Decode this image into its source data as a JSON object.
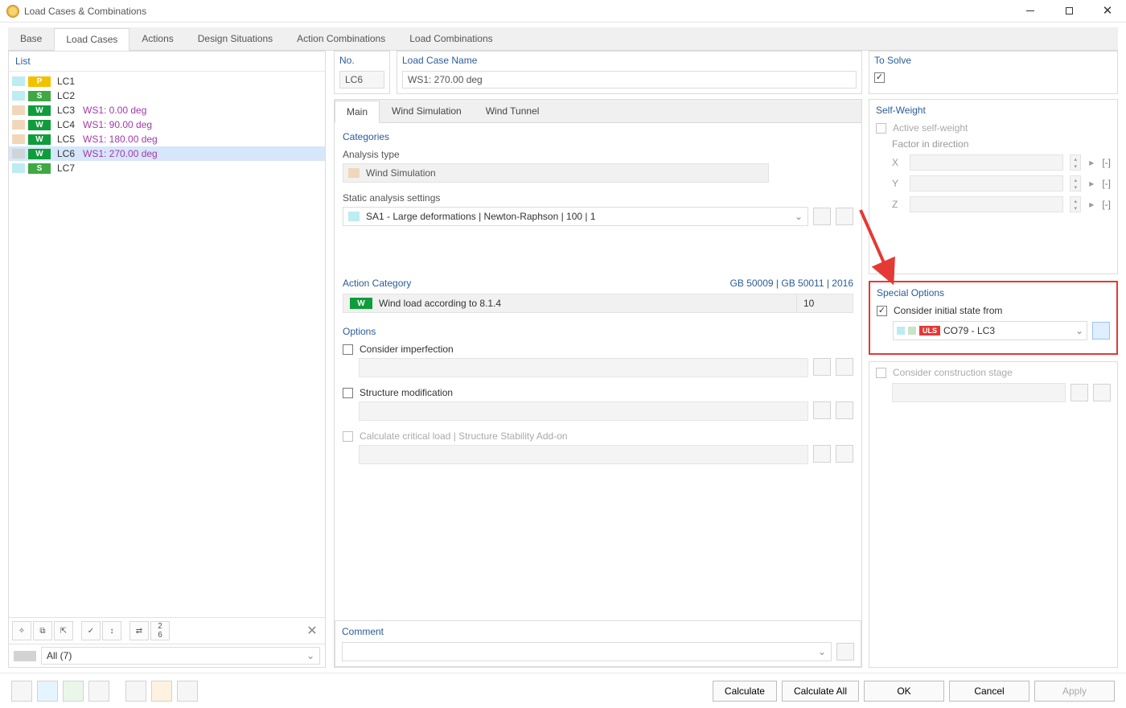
{
  "window": {
    "title": "Load Cases & Combinations"
  },
  "mainTabs": [
    "Base",
    "Load Cases",
    "Actions",
    "Design Situations",
    "Action Combinations",
    "Load Combinations"
  ],
  "mainTabActive": 1,
  "list": {
    "header": "List",
    "items": [
      {
        "sw": "cyan",
        "badge": "P",
        "badgeCls": "P",
        "id": "LC1",
        "name": ""
      },
      {
        "sw": "cyan",
        "badge": "S",
        "badgeCls": "S",
        "id": "LC2",
        "name": ""
      },
      {
        "sw": "tan",
        "badge": "W",
        "badgeCls": "W",
        "id": "LC3",
        "name": "WS1: 0.00 deg"
      },
      {
        "sw": "tan",
        "badge": "W",
        "badgeCls": "W",
        "id": "LC4",
        "name": "WS1: 90.00 deg"
      },
      {
        "sw": "tan",
        "badge": "W",
        "badgeCls": "W",
        "id": "LC5",
        "name": "WS1: 180.00 deg"
      },
      {
        "sw": "grey",
        "badge": "W",
        "badgeCls": "W",
        "id": "LC6",
        "name": "WS1: 270.00 deg",
        "sel": true
      },
      {
        "sw": "cyan",
        "badge": "S",
        "badgeCls": "S",
        "id": "LC7",
        "name": ""
      }
    ],
    "filter": "All (7)"
  },
  "no": {
    "label": "No.",
    "value": "LC6"
  },
  "name": {
    "label": "Load Case Name",
    "value": "WS1: 270.00 deg"
  },
  "solve": {
    "label": "To Solve"
  },
  "subTabs": [
    "Main",
    "Wind Simulation",
    "Wind Tunnel"
  ],
  "subTabActive": 0,
  "categories": {
    "header": "Categories",
    "analysisTypeLabel": "Analysis type",
    "analysisTypeValue": "Wind Simulation",
    "staticLabel": "Static analysis settings",
    "staticValue": "SA1 - Large deformations | Newton-Raphson | 100 | 1"
  },
  "actionCat": {
    "header": "Action Category",
    "standards": "GB 50009 | GB 50011 | 2016",
    "text": "Wind load according to 8.1.4",
    "num": "10"
  },
  "options": {
    "header": "Options",
    "imperfection": "Consider imperfection",
    "structure": "Structure modification",
    "critical": "Calculate critical load | Structure Stability Add-on"
  },
  "selfWeight": {
    "header": "Self-Weight",
    "active": "Active self-weight",
    "factorHdr": "Factor in direction",
    "axes": [
      "X",
      "Y",
      "Z"
    ],
    "unit": "[-]"
  },
  "special": {
    "header": "Special Options",
    "initial": "Consider initial state from",
    "combo": "CO79 - LC3",
    "uls": "ULS",
    "construction": "Consider construction stage"
  },
  "comment": {
    "header": "Comment"
  },
  "footerButtons": {
    "calculate": "Calculate",
    "calculateAll": "Calculate All",
    "ok": "OK",
    "cancel": "Cancel",
    "apply": "Apply"
  }
}
